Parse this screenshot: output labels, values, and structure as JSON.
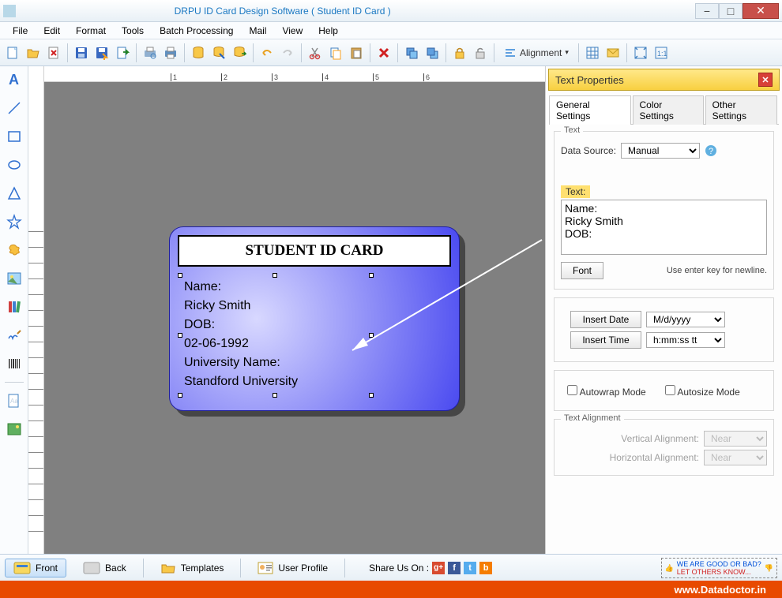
{
  "window": {
    "title": "DRPU ID Card Design Software ( Student ID Card )"
  },
  "menu": {
    "items": [
      "File",
      "Edit",
      "Format",
      "Tools",
      "Batch Processing",
      "Mail",
      "View",
      "Help"
    ]
  },
  "toolbar": {
    "alignment_label": "Alignment"
  },
  "ruler": {
    "marks": [
      "1",
      "2",
      "3",
      "4",
      "5",
      "6"
    ]
  },
  "card": {
    "title": "STUDENT ID CARD",
    "lines": [
      "Name:",
      "Ricky Smith",
      "DOB:",
      "02-06-1992",
      "University Name:",
      "Standford University"
    ]
  },
  "panel": {
    "title": "Text Properties",
    "tabs": [
      "General Settings",
      "Color Settings",
      "Other Settings"
    ],
    "active_tab": 0,
    "text_group_label": "Text",
    "datasource_label": "Data Source:",
    "datasource_value": "Manual",
    "text_label": "Text:",
    "text_value": "Name:\nRicky Smith\nDOB:",
    "font_btn": "Font",
    "hint": "Use enter key for newline.",
    "insert_date_btn": "Insert Date",
    "date_format": "M/d/yyyy",
    "insert_time_btn": "Insert Time",
    "time_format": "h:mm:ss tt",
    "autowrap_label": "Autowrap Mode",
    "autosize_label": "Autosize Mode",
    "alignment_legend": "Text Alignment",
    "valign_label": "Vertical Alignment:",
    "valign_value": "Near",
    "halign_label": "Horizontal  Alignment:",
    "halign_value": "Near"
  },
  "bottom": {
    "front": "Front",
    "back": "Back",
    "templates": "Templates",
    "user_profile": "User Profile",
    "share_label": "Share Us On :",
    "feedback_l1": "WE ARE GOOD OR BAD?",
    "feedback_l2": "LET OTHERS KNOW..."
  },
  "footer": {
    "url": "www.Datadoctor.in"
  }
}
